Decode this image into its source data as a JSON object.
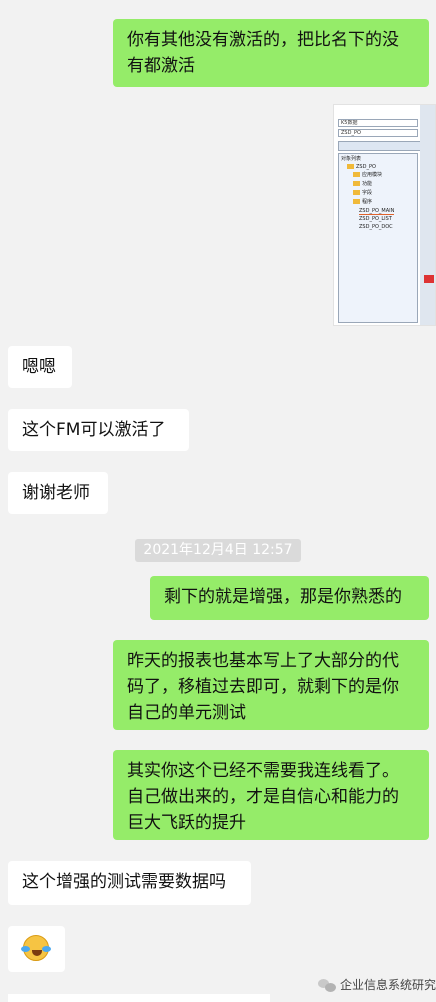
{
  "messages": {
    "m1": "你有其他没有激活的，把比名下的没有都激活",
    "m2": "嗯嗯",
    "m3": "这个FM可以激活了",
    "m4": "谢谢老师",
    "timestamp": "2021年12月4日 12:57",
    "m5": "剩下的就是增强，那是你熟悉的",
    "m6": "昨天的报表也基本写上了大部分的代码了，移植过去即可，就剩下的是你自己的单元测试",
    "m7": "其实你这个已经不需要我连线看了。自己做出来的，才是自信心和能力的巨大飞跃的提升",
    "m8": "这个增强的测试需要数据吗"
  },
  "screenshot_thumb": {
    "field1": "K5数据",
    "field2": "ZSD_PO",
    "tree_title": "对象列表",
    "tree_items": [
      "ZSD_PO",
      "应用模块",
      "功能",
      "字段",
      "程序",
      "ZSD_PO_MAIN",
      "ZSD_PO_LIST",
      "ZSD_PO_DOC"
    ]
  },
  "emoji": "laughing-crying-face",
  "watermark": "企业信息系统研究",
  "colors": {
    "outgoing": "#95ec69",
    "incoming": "#ffffff",
    "background": "#f2f2f2"
  }
}
